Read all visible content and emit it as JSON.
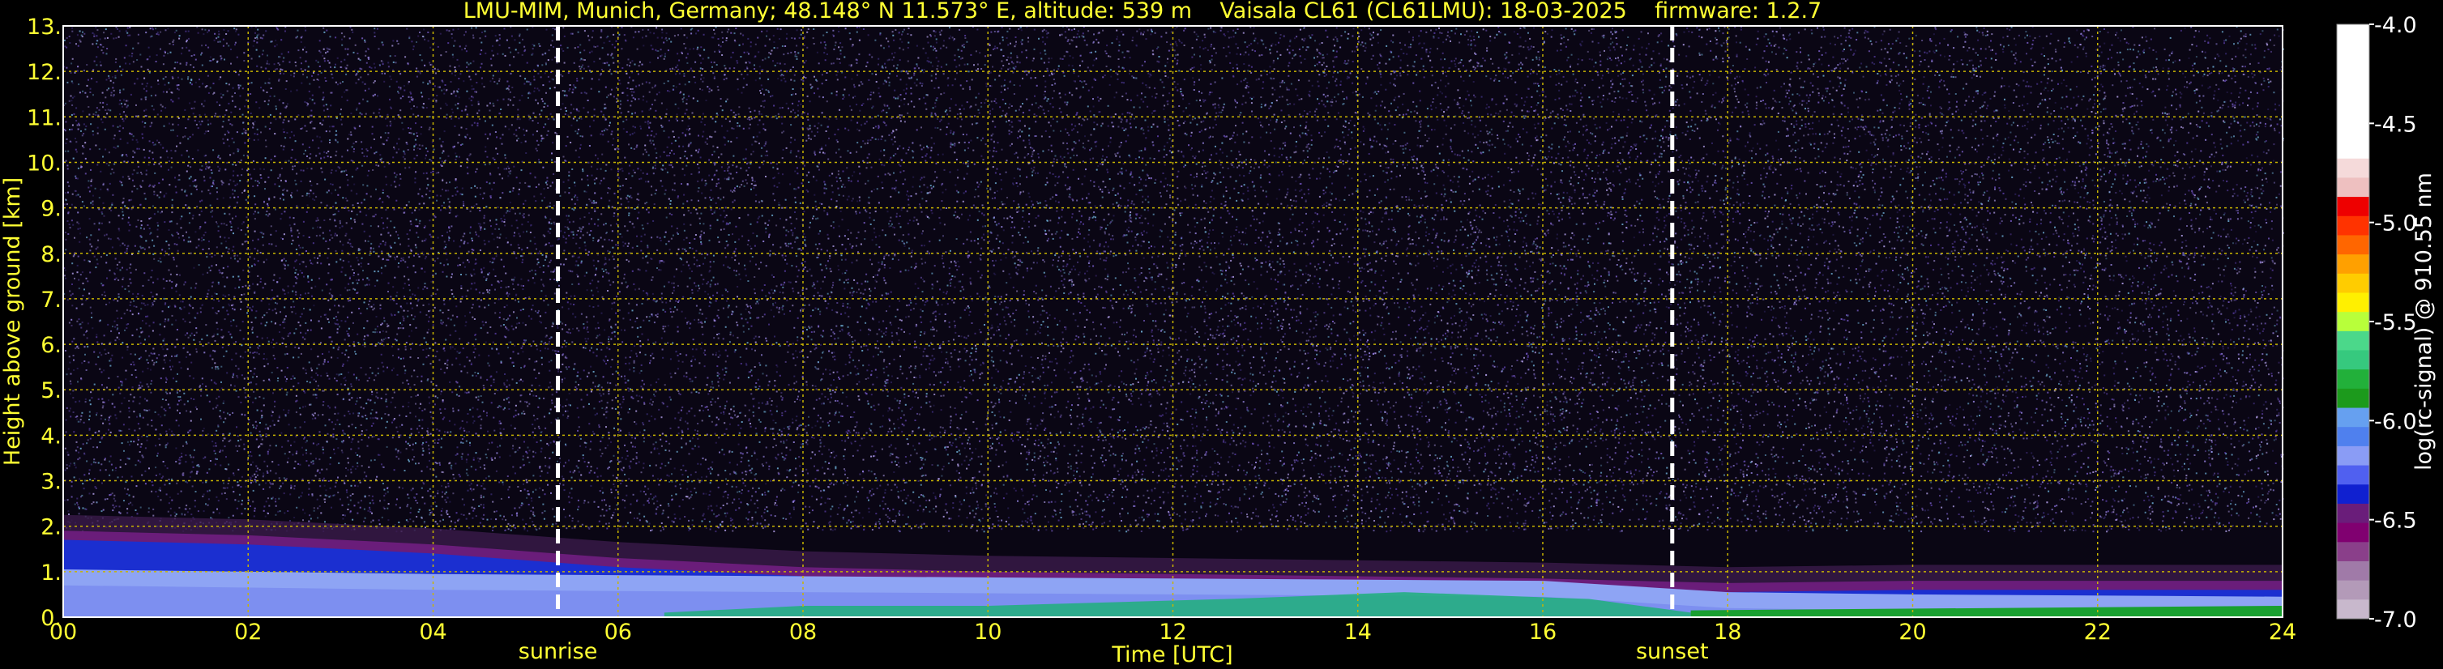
{
  "title": "LMU-MIM, Munich, Germany; 48.148° N 11.573° E, altitude: 539 m    Vaisala CL61 (CL61LMU): 18-03-2025    firmware: 1.2.7",
  "chart_data": {
    "type": "heatmap",
    "xlabel": "Time [UTC]",
    "ylabel": "Height above ground [km]",
    "xlim": [
      0,
      24
    ],
    "ylim": [
      0,
      13
    ],
    "x_ticks": [
      "00",
      "02",
      "04",
      "06",
      "08",
      "10",
      "12",
      "14",
      "16",
      "18",
      "20",
      "22",
      "24"
    ],
    "y_ticks": [
      "0.",
      "1.",
      "2.",
      "3.",
      "4.",
      "5.",
      "6.",
      "7.",
      "8.",
      "9.",
      "10.",
      "11.",
      "12.",
      "13."
    ],
    "grid": true,
    "annotations": [
      {
        "label": "sunrise",
        "x": 5.35
      },
      {
        "label": "sunset",
        "x": 17.4
      }
    ],
    "colorbar": {
      "label": "log(rc-signal) @ 910.55 nm",
      "range": [
        -7.0,
        -4.0
      ],
      "ticks": [
        "-4.0",
        "-4.5",
        "-5.0",
        "-5.5",
        "-6.0",
        "-6.5",
        "-7.0"
      ]
    },
    "features": {
      "boundary_layer_top_km": [
        [
          0,
          1.9
        ],
        [
          2,
          1.8
        ],
        [
          4,
          1.6
        ],
        [
          6,
          1.3
        ],
        [
          8,
          1.1
        ],
        [
          10,
          1.0
        ],
        [
          12,
          0.95
        ],
        [
          14,
          0.9
        ],
        [
          16,
          0.85
        ],
        [
          18,
          0.75
        ],
        [
          20,
          0.8
        ],
        [
          22,
          0.8
        ],
        [
          24,
          0.8
        ]
      ],
      "strong_layer_top_km": [
        [
          0,
          1.05
        ],
        [
          4,
          0.95
        ],
        [
          8,
          0.9
        ],
        [
          12,
          0.85
        ],
        [
          16,
          0.8
        ],
        [
          18,
          0.55
        ],
        [
          20,
          0.5
        ],
        [
          24,
          0.45
        ]
      ]
    }
  },
  "colors": {
    "text": "#ffff33",
    "grid": "#c8b400",
    "background": "#000000",
    "noise": [
      "#7a5ec8",
      "#5b3fa8",
      "#9a88e6",
      "#6fb0d8",
      "#b7a4ef",
      "#3c2f7a"
    ]
  }
}
